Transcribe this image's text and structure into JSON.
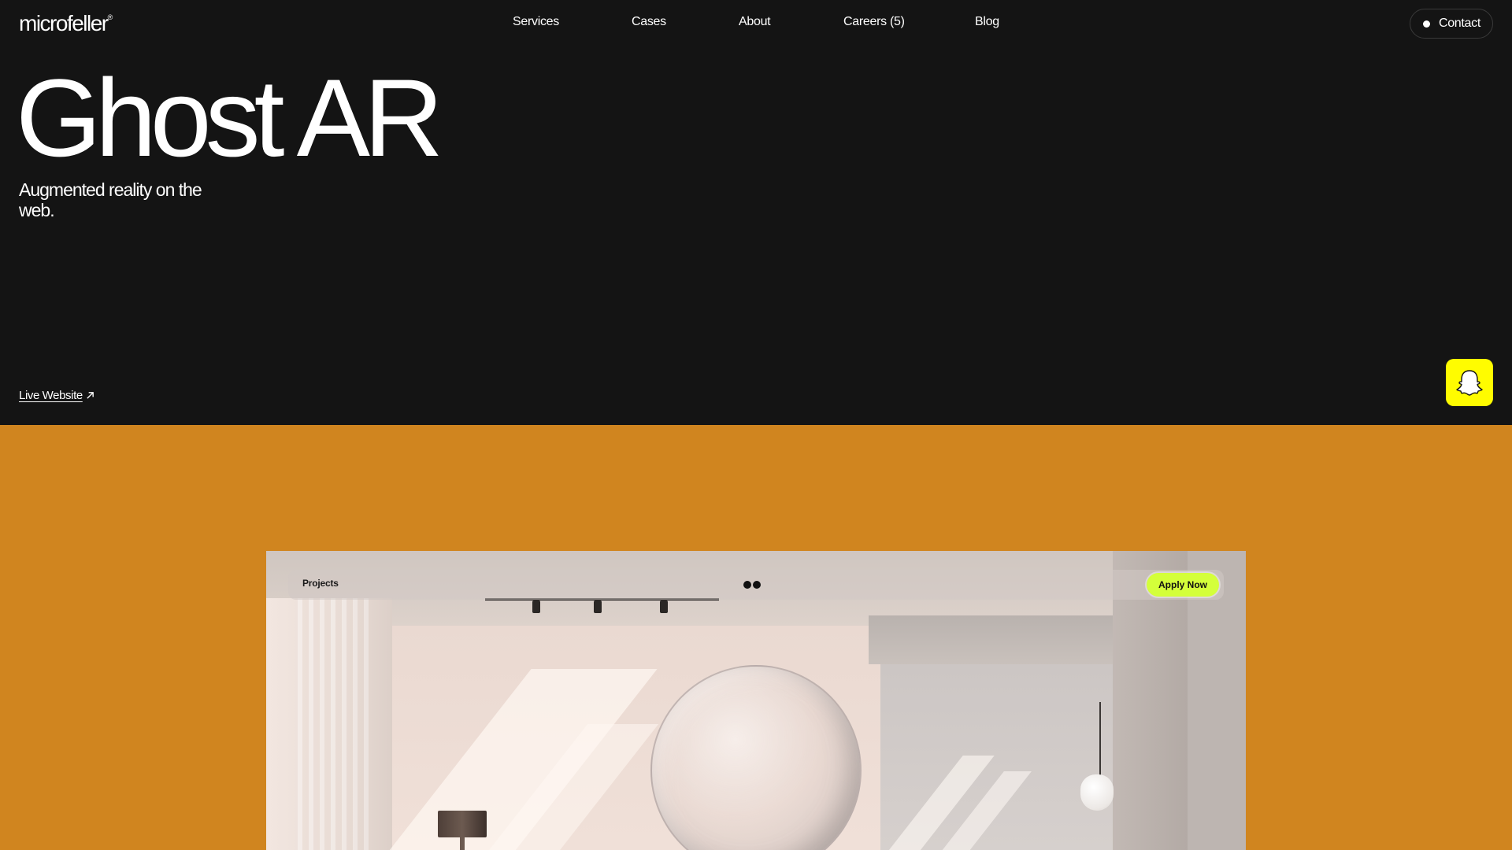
{
  "brand": {
    "name": "microfeller",
    "mark": "®"
  },
  "nav": {
    "items": [
      {
        "label": "Services"
      },
      {
        "label": "Cases"
      },
      {
        "label": "About"
      },
      {
        "label": "Careers (5)"
      },
      {
        "label": "Blog"
      }
    ],
    "contact_label": "Contact"
  },
  "hero": {
    "title": "Ghost AR",
    "subtitle": "Augmented reality on the web.",
    "live_link_label": "Live Website"
  },
  "client_icon": {
    "name": "snapchat-ghost-icon",
    "color": "#fffc00"
  },
  "section": {
    "background": "#d0851f"
  },
  "mockup": {
    "nav_left_label": "Projects",
    "apply_label": "Apply Now",
    "apply_color": "#d4ff3a"
  }
}
